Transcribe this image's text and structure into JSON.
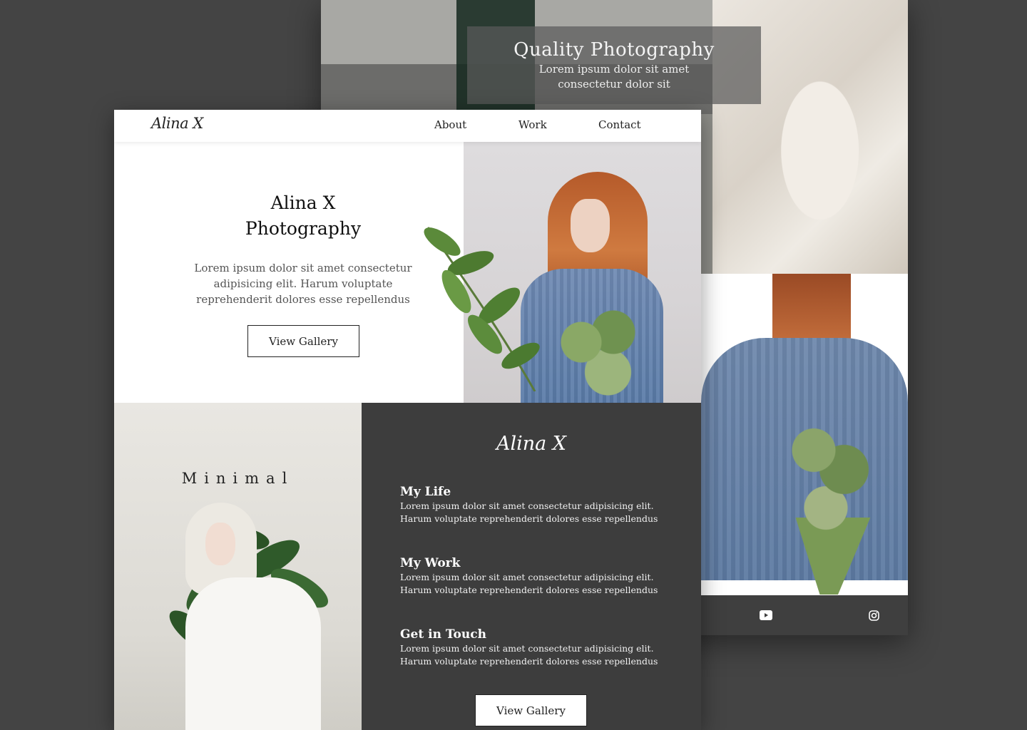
{
  "back_page": {
    "overlay_title": "Quality Photography",
    "overlay_subtitle": "Lorem ipsum dolor sit amet consectetur dolor sit",
    "footer_icons": [
      "youtube-icon",
      "instagram-icon"
    ]
  },
  "front_page": {
    "logo": "Alina X",
    "nav": {
      "about": "About",
      "work": "Work",
      "contact": "Contact"
    },
    "hero": {
      "title_line1": "Alina X",
      "title_line2": "Photography",
      "text": "Lorem ipsum dolor sit amet consectetur adipisicing elit. Harum voluptate reprehenderit dolores esse repellendus",
      "button": "View Gallery"
    },
    "minimal": {
      "label": "Minimal"
    },
    "info": {
      "logo": "Alina X",
      "sections": [
        {
          "title": "My Life",
          "text": "Lorem ipsum dolor sit amet consectetur adipisicing elit. Harum voluptate reprehenderit dolores esse repellendus"
        },
        {
          "title": "My Work",
          "text": "Lorem ipsum dolor sit amet consectetur adipisicing elit. Harum voluptate reprehenderit dolores esse repellendus"
        },
        {
          "title": "Get in Touch",
          "text": "Lorem ipsum dolor sit amet consectetur adipisicing elit. Harum voluptate reprehenderit dolores esse repellendus"
        }
      ],
      "button": "View Gallery"
    }
  },
  "colors": {
    "background": "#444444",
    "dark_panel": "#3d3d3d",
    "sweater_blue": "#6f8ab3",
    "leaf_green": "#4f7a3a"
  }
}
